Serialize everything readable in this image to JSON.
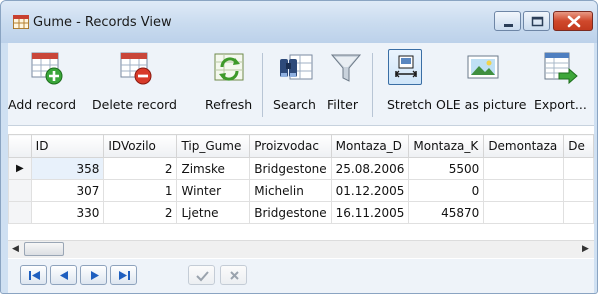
{
  "window": {
    "title": "Gume - Records View"
  },
  "toolbar": {
    "add_label": "Add record",
    "delete_label": "Delete record",
    "refresh_label": "Refresh",
    "search_label": "Search",
    "filter_label": "Filter",
    "stretch_label": "Stretch",
    "ole_label": "OLE as picture",
    "export_label": "Export..."
  },
  "grid": {
    "columns": [
      "ID",
      "IDVozilo",
      "Tip_Gume",
      "Proizvodac",
      "Montaza_D",
      "Montaza_K",
      "Demontaza",
      "De"
    ],
    "rows": [
      {
        "ID": "358",
        "IDVozilo": "2",
        "Tip_Gume": "Zimske",
        "Proizvodac": "Bridgestone",
        "Montaza_D": "25.08.2006",
        "Montaza_K": "5500",
        "Demontaza": "",
        "De": ""
      },
      {
        "ID": "307",
        "IDVozilo": "1",
        "Tip_Gume": "Winter",
        "Proizvodac": "Michelin",
        "Montaza_D": "01.12.2005",
        "Montaza_K": "0",
        "Demontaza": "",
        "De": ""
      },
      {
        "ID": "330",
        "IDVozilo": "2",
        "Tip_Gume": "Ljetne",
        "Proizvodac": "Bridgestone",
        "Montaza_D": "16.11.2005",
        "Montaza_K": "45870",
        "Demontaza": "",
        "De": ""
      }
    ],
    "current_row_marker": "▶"
  },
  "scroll": {
    "left_arrow": "◀",
    "right_arrow": "▶"
  },
  "icons": [
    "app-table-icon",
    "add-record-icon",
    "delete-record-icon",
    "refresh-icon",
    "search-binoculars-icon",
    "filter-funnel-icon",
    "stretch-icon",
    "ole-picture-icon",
    "export-icon",
    "first-record-icon",
    "prev-record-icon",
    "next-record-icon",
    "last-record-icon",
    "post-check-icon",
    "cancel-x-icon"
  ]
}
